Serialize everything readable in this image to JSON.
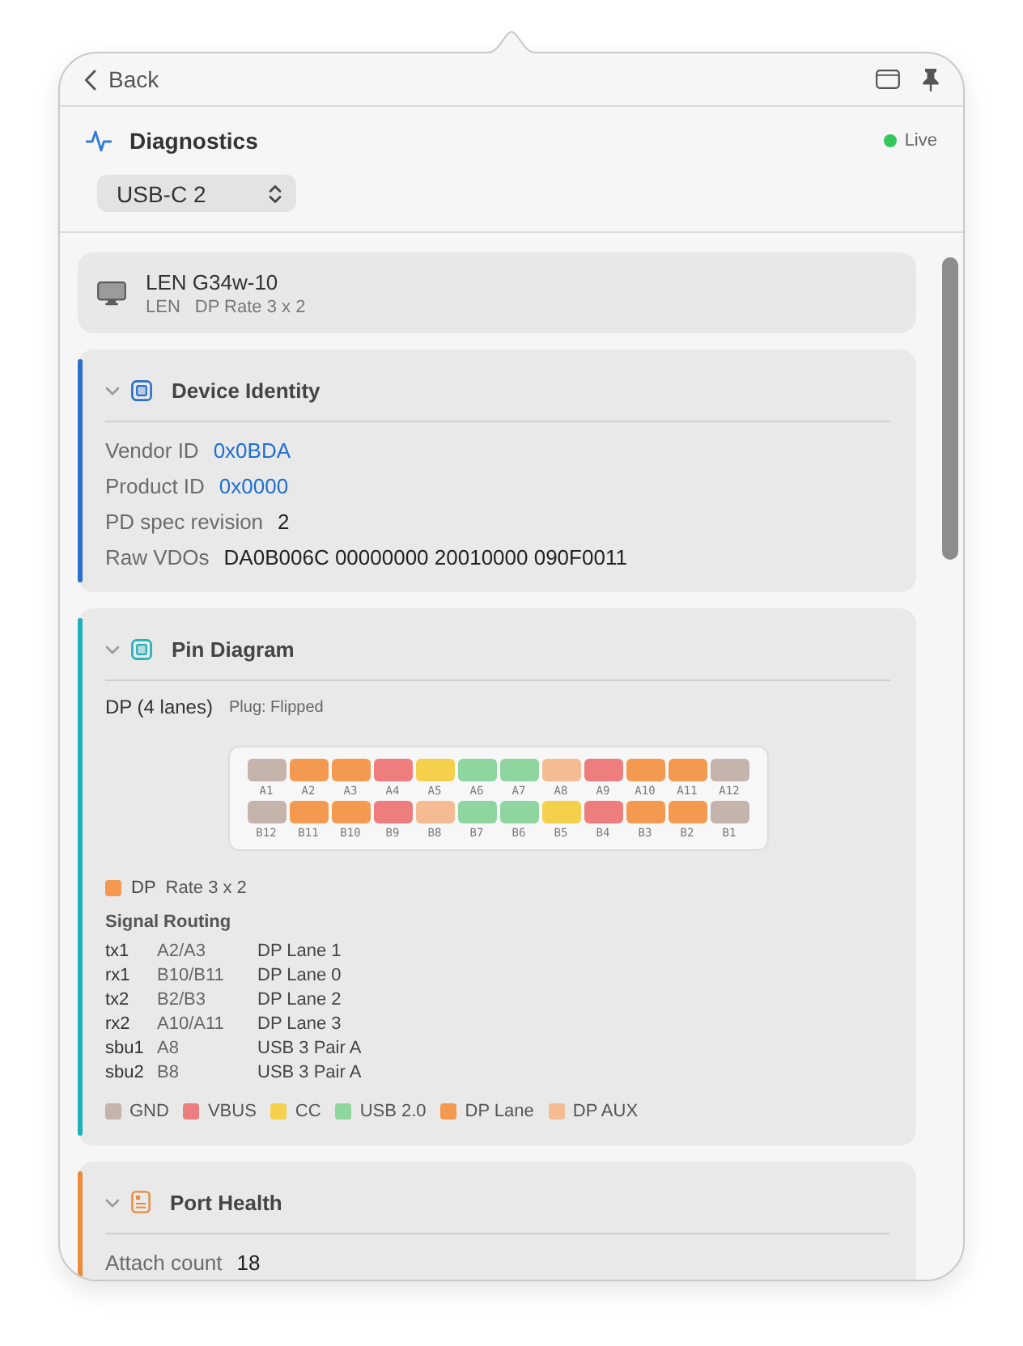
{
  "nav": {
    "back_label": "Back"
  },
  "header": {
    "title": "Diagnostics",
    "status": {
      "label": "Live",
      "live": true
    },
    "port_select": {
      "value": "USB-C 2"
    }
  },
  "device": {
    "name": "LEN G34w-10",
    "vendor": "LEN",
    "detail": "DP Rate 3 x 2"
  },
  "sections": [
    {
      "kind": "identity",
      "title": "Device Identity",
      "color": "#2a6fc9",
      "expanded": true,
      "fields": [
        {
          "label": "Vendor ID",
          "value": "0x0BDA",
          "kind": "link"
        },
        {
          "label": "Product ID",
          "value": "0x0000",
          "kind": "link"
        },
        {
          "label": "PD spec revision",
          "value": "2",
          "kind": "text"
        },
        {
          "label": "Raw VDOs",
          "value": "DA0B006C 00000000 20010000 090F0011",
          "kind": "text"
        }
      ]
    },
    {
      "kind": "pins",
      "title": "Pin Diagram",
      "color": "#1fb0b8",
      "expanded": true,
      "mode": "DP (4 lanes)",
      "plug": "Plug: Flipped",
      "pin_rows": [
        {
          "pins": [
            {
              "label": "A1",
              "color": "#c5b4ab"
            },
            {
              "label": "A2",
              "color": "#f39a50"
            },
            {
              "label": "A3",
              "color": "#f39a50"
            },
            {
              "label": "A4",
              "color": "#ee7d7d"
            },
            {
              "label": "A5",
              "color": "#f5d04c"
            },
            {
              "label": "A6",
              "color": "#8fd5a0"
            },
            {
              "label": "A7",
              "color": "#8fd5a0"
            },
            {
              "label": "A8",
              "color": "#f5bc93"
            },
            {
              "label": "A9",
              "color": "#ee7d7d"
            },
            {
              "label": "A10",
              "color": "#f39a50"
            },
            {
              "label": "A11",
              "color": "#f39a50"
            },
            {
              "label": "A12",
              "color": "#c5b4ab"
            }
          ]
        },
        {
          "pins": [
            {
              "label": "B12",
              "color": "#c5b4ab"
            },
            {
              "label": "B11",
              "color": "#f39a50"
            },
            {
              "label": "B10",
              "color": "#f39a50"
            },
            {
              "label": "B9",
              "color": "#ee7d7d"
            },
            {
              "label": "B8",
              "color": "#f5bc93"
            },
            {
              "label": "B7",
              "color": "#8fd5a0"
            },
            {
              "label": "B6",
              "color": "#8fd5a0"
            },
            {
              "label": "B5",
              "color": "#f5d04c"
            },
            {
              "label": "B4",
              "color": "#ee7d7d"
            },
            {
              "label": "B3",
              "color": "#f39a50"
            },
            {
              "label": "B2",
              "color": "#f39a50"
            },
            {
              "label": "B1",
              "color": "#c5b4ab"
            }
          ]
        }
      ],
      "active_mode": {
        "label": "DP",
        "detail": "Rate 3 x 2",
        "color": "#f39a50"
      },
      "routing": {
        "title": "Signal Routing",
        "rows": [
          {
            "signal": "tx1",
            "pins": "A2/A3",
            "function": "DP Lane 1"
          },
          {
            "signal": "rx1",
            "pins": "B10/B11",
            "function": "DP Lane 0"
          },
          {
            "signal": "tx2",
            "pins": "B2/B3",
            "function": "DP Lane 2"
          },
          {
            "signal": "rx2",
            "pins": "A10/A11",
            "function": "DP Lane 3"
          },
          {
            "signal": "sbu1",
            "pins": "A8",
            "function": "USB 3 Pair A"
          },
          {
            "signal": "sbu2",
            "pins": "B8",
            "function": "USB 3 Pair A"
          }
        ]
      },
      "legend": [
        {
          "label": "GND",
          "color": "#c5b4ab"
        },
        {
          "label": "VBUS",
          "color": "#ee7d7d"
        },
        {
          "label": "CC",
          "color": "#f5d04c"
        },
        {
          "label": "USB 2.0",
          "color": "#8fd5a0"
        },
        {
          "label": "DP Lane",
          "color": "#f39a50"
        },
        {
          "label": "DP AUX",
          "color": "#f5bc93"
        }
      ]
    },
    {
      "kind": "health",
      "title": "Port Health",
      "color": "#e98b3c",
      "expanded": true,
      "fields": [
        {
          "label": "Attach count",
          "value": "18",
          "kind": "text"
        }
      ]
    }
  ]
}
